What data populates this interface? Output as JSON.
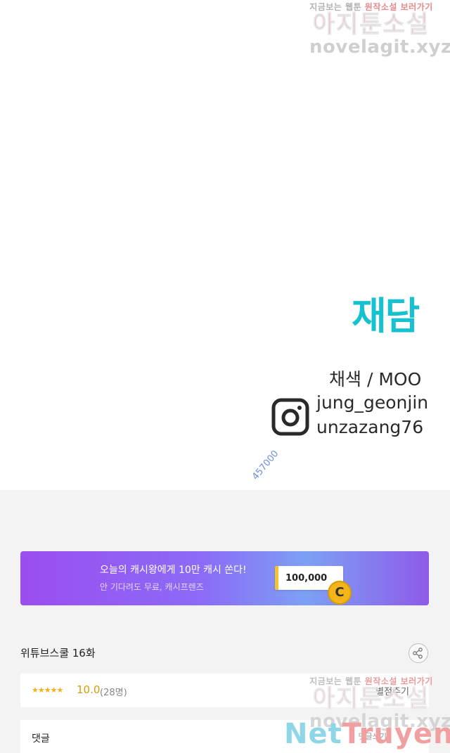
{
  "watermark": {
    "top_line_gray": "지금보는 웹툰",
    "top_line_red": "원작소설 보러가기",
    "brand": "아지툰소설",
    "url": "novelagit.xyz"
  },
  "credits": {
    "studio": "재담",
    "colorist": "채색 / MOO",
    "instagram_handles": [
      "jung_geonjin",
      "unzazang76"
    ],
    "icon": "instagram-icon"
  },
  "stamp": "457000",
  "banner": {
    "title": "오늘의 캐시왕에게 10만 캐시 쏜다!",
    "subtitle": "안 기다려도 무료, 캐시프렌즈",
    "amount": "100,000",
    "coin_letter": "C"
  },
  "episode": {
    "title": "위튜브스쿨 16화",
    "share_icon": "share-icon"
  },
  "rating": {
    "stars": "★★★★★",
    "score": "10.0",
    "count": "(28명)",
    "rate_button": "별점주기"
  },
  "comments": {
    "label": "댓글",
    "extra": "댓글쓰기"
  },
  "site_watermark": {
    "part1": "Net",
    "part2": "Truyen"
  },
  "colors": {
    "studio_teal": "#16c2d0",
    "banner_purple": "#9b4df0",
    "star_gold": "#f3b21c"
  }
}
